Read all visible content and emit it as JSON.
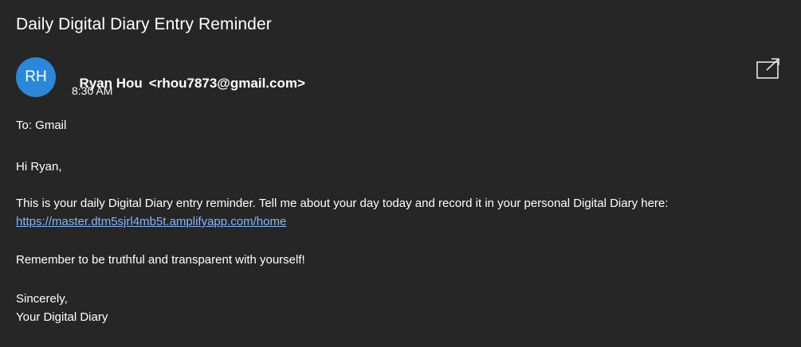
{
  "email": {
    "subject": "Daily Digital Diary Entry Reminder",
    "avatar_initials": "RH",
    "avatar_color": "#2b88d8",
    "sender_name": "Ryan Hou",
    "sender_email": "<rhou7873@gmail.com>",
    "time": "8:30 AM",
    "to_line": "To: Gmail",
    "greeting": "Hi Ryan,",
    "paragraph1": "This is your daily Digital Diary entry reminder. Tell me about your day today and record it in your personal Digital Diary here:",
    "link": "https://master.dtm5sjrl4mb5t.amplifyapp.com/home",
    "paragraph2": "Remember to be truthful and transparent with yourself!",
    "signoff_line1": "Sincerely,",
    "signoff_line2": "Your Digital Diary",
    "popout_icon": "popout-icon"
  }
}
